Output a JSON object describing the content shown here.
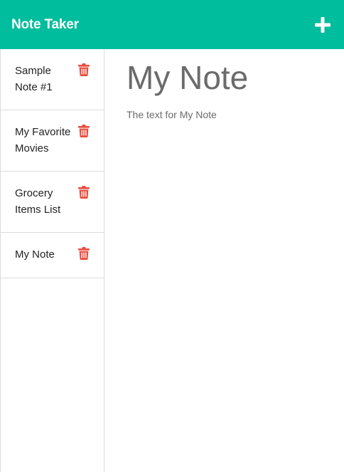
{
  "header": {
    "brand": "Note Taker",
    "new_note_icon": "plus-icon"
  },
  "colors": {
    "primary": "#00bd9d",
    "delete": "#e74c3c"
  },
  "sidebar": {
    "notes": [
      {
        "title": "Sample Note #1",
        "icon": "trash-icon"
      },
      {
        "title": "My Favorite Movies",
        "icon": "trash-icon"
      },
      {
        "title": "Grocery Items List",
        "icon": "trash-icon"
      },
      {
        "title": "My Note",
        "icon": "trash-icon"
      }
    ]
  },
  "editor": {
    "title": "My Note",
    "text": "The text for My Note"
  }
}
